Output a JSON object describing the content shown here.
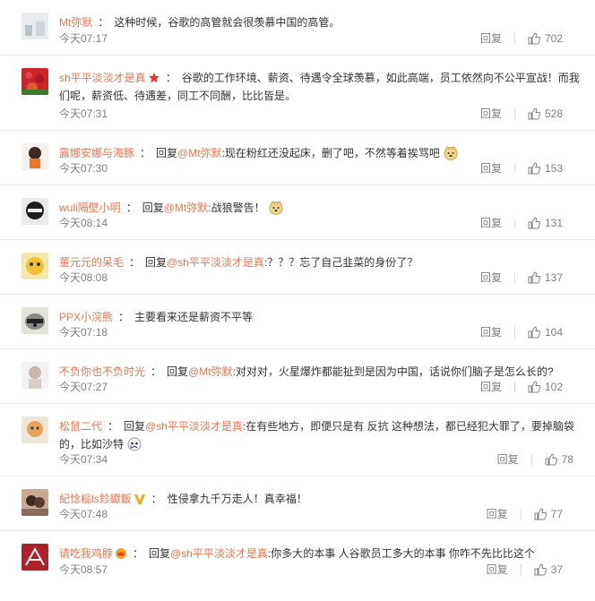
{
  "ui": {
    "reply_label": "回复"
  },
  "comments": [
    {
      "user": "Mt弥默",
      "reply_prefix": "",
      "mention": "",
      "after_mention": "",
      "text": "这种时候，谷歌的高管就会很羡慕中国的高管。",
      "time": "今天07:17",
      "likes": "702"
    },
    {
      "user": "sh平平淡淡才是真",
      "reply_prefix": "",
      "mention": "",
      "after_mention": "",
      "text": "谷歌的工作环境、薪资、待遇令全球羡慕，如此高端，员工依然向不公平宣战！而我们呢，薪资低、待遇差，同工不同酬，比比皆是。",
      "time": "今天07:31",
      "likes": "528"
    },
    {
      "user": "露娜安娜与海豚",
      "reply_prefix": "回复",
      "mention": "@Mt弥默",
      "after_mention": ":现在粉红还没起床，删了吧，不然等着挨骂吧",
      "text": "",
      "time": "今天07:30",
      "likes": "153"
    },
    {
      "user": "wuli隔壁小明",
      "reply_prefix": "回复",
      "mention": "@Mt弥默",
      "after_mention": ":战狼警告！",
      "text": "",
      "time": "今天08:14",
      "likes": "131"
    },
    {
      "user": "董元元的呆毛",
      "reply_prefix": "回复",
      "mention": "@sh平平淡淡才是真",
      "after_mention": ":？？？忘了自己韭菜的身份了？",
      "text": "",
      "time": "今天08:08",
      "likes": "137"
    },
    {
      "user": "PPX小浣熊",
      "reply_prefix": "",
      "mention": "",
      "after_mention": "",
      "text": "主要看来还是薪资不平等",
      "time": "今天07:18",
      "likes": "104"
    },
    {
      "user": "不负你也不负时光",
      "reply_prefix": "回复",
      "mention": "@Mt弥默",
      "after_mention": ":对对对，火星爆炸都能扯到是因为中国，话说你们脑子是怎么长的?",
      "text": "",
      "time": "今天07:27",
      "likes": "102"
    },
    {
      "user": "松鼠二代",
      "reply_prefix": "回复",
      "mention": "@sh平平淡淡才是真",
      "after_mention": ":在有些地方，即便只是有 反抗 这种想法，都已经犯大罪了，要掉脑袋的，比如沙特",
      "text": "",
      "time": "今天07:34",
      "likes": "78"
    },
    {
      "user": "紀惗榀ls鉁钀鈑",
      "reply_prefix": "",
      "mention": "",
      "after_mention": "",
      "text": "性侵拿九千万走人！真幸福！",
      "time": "今天07:48",
      "likes": "77"
    },
    {
      "user": "请吃我鸡脖",
      "reply_prefix": "回复",
      "mention": "@sh平平淡淡才是真",
      "after_mention": ":你多大的本事 人谷歌员工多大的本事 你咋不先比比这个",
      "text": "",
      "time": "今天08:57",
      "likes": "37"
    }
  ]
}
